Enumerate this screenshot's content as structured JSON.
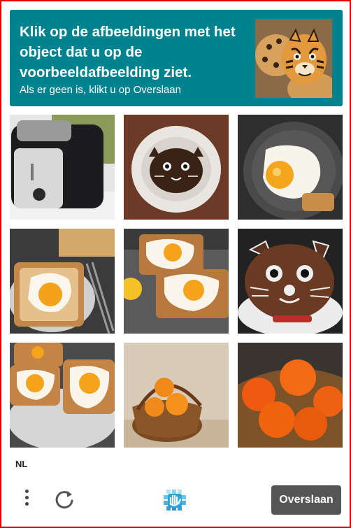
{
  "header": {
    "prompt": "Klik op de afbeeldingen met het object dat u op de voorbeeldafbeelding ziet.",
    "hint": "Als er geen is, klikt u op Overslaan",
    "example_image": "tiger-face-cookies"
  },
  "grid": {
    "tiles": [
      {
        "subject": "toaster"
      },
      {
        "subject": "cat-face-cookie-on-plate"
      },
      {
        "subject": "fried-egg-on-plate"
      },
      {
        "subject": "egg-toast-with-fork"
      },
      {
        "subject": "egg-toasts-on-plate"
      },
      {
        "subject": "cat-face-cookie"
      },
      {
        "subject": "egg-toasts-on-plate"
      },
      {
        "subject": "oranges-in-basket"
      },
      {
        "subject": "oranges-in-basket"
      }
    ]
  },
  "footer": {
    "language": "NL",
    "skip_label": "Overslaan",
    "menu_icon": "vertical-dots-icon",
    "refresh_icon": "refresh-icon",
    "logo": "hcaptcha-logo"
  },
  "colors": {
    "banner": "#00838f",
    "skip_button": "#555555",
    "frame_border": "#e00000"
  }
}
